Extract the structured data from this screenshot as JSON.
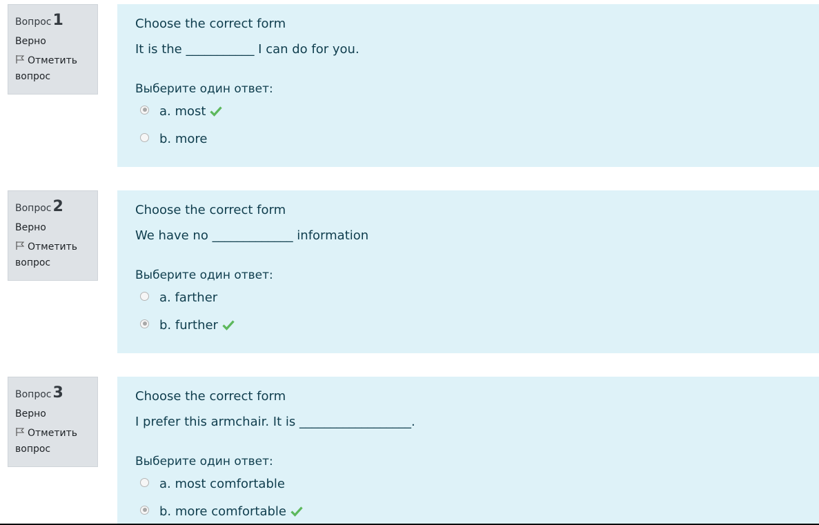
{
  "questions": [
    {
      "label": "Вопрос",
      "number": "1",
      "state": "Верно",
      "flag_label": "Отметить вопрос",
      "title": "Choose the correct form",
      "text": "It is the ___________ I can do for you.",
      "prompt": "Выберите один ответ:",
      "answers": [
        {
          "label": "a. most",
          "selected": true,
          "correct_icon": "check-icon"
        },
        {
          "label": "b. more",
          "selected": false
        }
      ]
    },
    {
      "label": "Вопрос",
      "number": "2",
      "state": "Верно",
      "flag_label": "Отметить вопрос",
      "title": "Choose the correct form",
      "text": "We have no _____________ information",
      "prompt": "Выберите один ответ:",
      "answers": [
        {
          "label": "a. farther",
          "selected": false
        },
        {
          "label": "b. further",
          "selected": true,
          "correct_icon": "check-icon"
        }
      ]
    },
    {
      "label": "Вопрос",
      "number": "3",
      "state": "Верно",
      "flag_label": "Отметить вопрос",
      "title": "Choose the correct form",
      "text": "I prefer this armchair. It is __________________.",
      "prompt": "Выберите один ответ:",
      "answers": [
        {
          "label": "a. most comfortable",
          "selected": false
        },
        {
          "label": "b. more comfortable",
          "selected": true,
          "correct_icon": "check-icon"
        }
      ]
    }
  ],
  "colors": {
    "info_bg": "#dee2e6",
    "content_bg": "#def2f8",
    "text": "#0f3d4d",
    "correct": "#5cb85c"
  }
}
